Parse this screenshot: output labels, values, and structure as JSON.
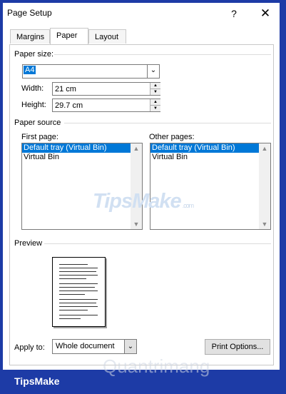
{
  "window": {
    "title": "Page Setup",
    "help": "?",
    "close": "✕"
  },
  "tabs": [
    {
      "label": "Margins"
    },
    {
      "label": "Paper"
    },
    {
      "label": "Layout"
    }
  ],
  "paper_size": {
    "section": "Paper size:",
    "selected": "A4",
    "width_label": "Width:",
    "width_value": "21 cm",
    "height_label": "Height:",
    "height_value": "29.7 cm"
  },
  "paper_source": {
    "section": "Paper source",
    "first_page_label": "First page:",
    "first_page_items": [
      "Default tray (Virtual Bin)",
      "Virtual Bin"
    ],
    "other_pages_label": "Other pages:",
    "other_pages_items": [
      "Default tray (Virtual Bin)",
      "Virtual Bin"
    ]
  },
  "preview": {
    "section": "Preview"
  },
  "apply_to": {
    "label": "Apply to:",
    "value": "Whole document"
  },
  "buttons": {
    "print_options": "Print Options..."
  },
  "watermarks": {
    "center": "TipsMake",
    "center_sub": ".com",
    "bottom": "Quantrimang"
  },
  "brand": {
    "text": "TipsMake"
  },
  "colors": {
    "background": "#1d3ba6",
    "selection": "#0078d7"
  },
  "icons": {
    "dropdown": "chevron-down-icon",
    "spin": "spin-arrows-icon",
    "close": "close-icon",
    "help": "help-icon"
  }
}
